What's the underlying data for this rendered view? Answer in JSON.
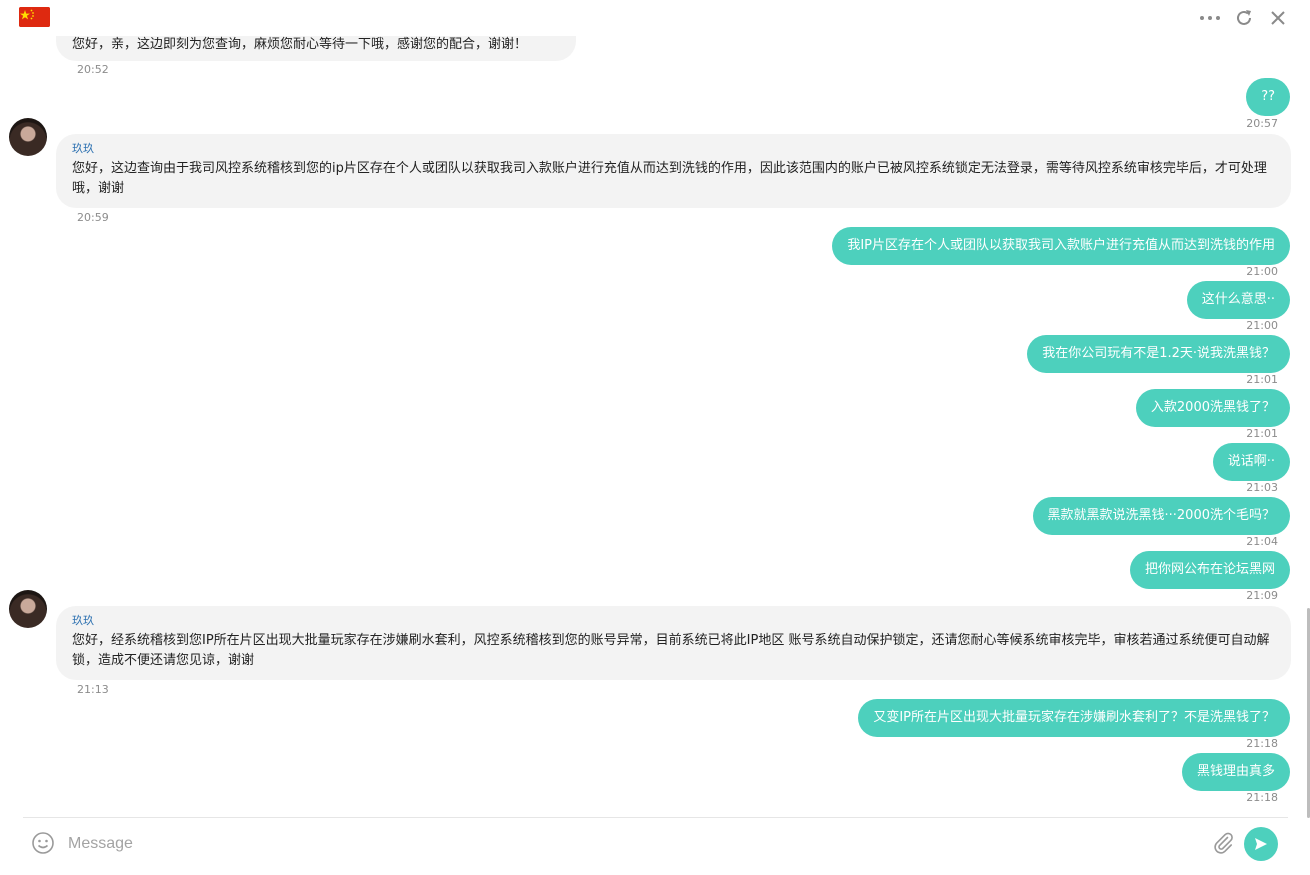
{
  "header": {
    "flag_icon": "china-flag-icon",
    "icons": [
      "more-icon",
      "refresh-icon",
      "close-icon"
    ]
  },
  "composer": {
    "placeholder": "Message",
    "emoji_icon": "smiley-icon",
    "attach_icon": "paperclip-icon",
    "send_icon": "send-icon"
  },
  "messages": {
    "m0": {
      "text": "您好，亲，这边即刻为您查询，麻烦您耐心等待一下哦，感谢您的配合，谢谢！",
      "time": "20:52"
    },
    "m1": {
      "text": "??",
      "time": "20:57"
    },
    "m2": {
      "name": "玖玖",
      "text": "您好，这边查询由于我司风控系统稽核到您的ip片区存在个人或团队以获取我司入款账户进行充值从而达到洗钱的作用，因此该范围内的账户已被风控系统锁定无法登录，需等待风控系统审核完毕后，才可处理哦，谢谢",
      "time": "20:59"
    },
    "m3": {
      "text": "我IP片区存在个人或团队以获取我司入款账户进行充值从而达到洗钱的作用",
      "time": "21:00"
    },
    "m4": {
      "text": "这什么意思··",
      "time": "21:00"
    },
    "m5": {
      "text": "我在你公司玩有不是1.2天·说我洗黑钱？",
      "time": "21:01"
    },
    "m6": {
      "text": "入款2000洗黑钱了？",
      "time": "21:01"
    },
    "m7": {
      "text": "说话啊··",
      "time": "21:03"
    },
    "m8": {
      "text": "黑款就黑款说洗黑钱···2000洗个毛吗？",
      "time": "21:04"
    },
    "m9": {
      "text": "把你网公布在论坛黑网",
      "time": "21:09"
    },
    "m10": {
      "name": "玖玖",
      "text": "您好，经系统稽核到您IP所在片区出现大批量玩家存在涉嫌刷水套利，风控系统稽核到您的账号异常，目前系统已将此IP地区 账号系统自动保护锁定，还请您耐心等候系统审核完毕，审核若通过系统便可自动解锁，造成不便还请您见谅，谢谢",
      "time": "21:13"
    },
    "m11": {
      "text": "又变IP所在片区出现大批量玩家存在涉嫌刷水套利了？不是洗黑钱了？",
      "time": "21:18"
    },
    "m12": {
      "text": "黑钱理由真多",
      "time": "21:18"
    }
  },
  "colors": {
    "user_bubble": "#4dd0bd",
    "agent_bubble": "#f3f3f3",
    "agent_name": "#2a6fb0",
    "flag_red": "#de2910",
    "flag_star": "#ffde00"
  }
}
